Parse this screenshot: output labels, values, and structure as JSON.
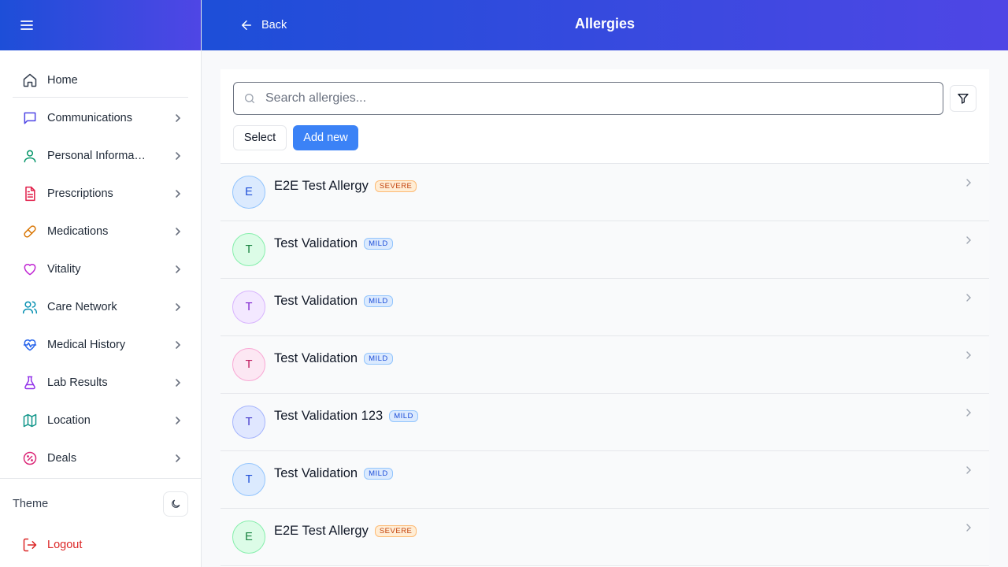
{
  "sidebar": {
    "items": [
      {
        "label": "Home",
        "icon": "home-icon",
        "color": "#374151"
      },
      {
        "label": "Communications",
        "icon": "message-square-icon",
        "color": "#4f46e5"
      },
      {
        "label": "Personal Information",
        "icon": "user-icon",
        "color": "#059669"
      },
      {
        "label": "Prescriptions",
        "icon": "file-text-icon",
        "color": "#e11d48"
      },
      {
        "label": "Medications",
        "icon": "pill-icon",
        "color": "#d97706"
      },
      {
        "label": "Vitality",
        "icon": "heart-icon",
        "color": "#c026d3"
      },
      {
        "label": "Care Network",
        "icon": "users-icon",
        "color": "#0891b2"
      },
      {
        "label": "Medical History",
        "icon": "heart-pulse-icon",
        "color": "#2563eb"
      },
      {
        "label": "Lab Results",
        "icon": "flask-icon",
        "color": "#9333ea"
      },
      {
        "label": "Location",
        "icon": "map-icon",
        "color": "#0d9488"
      },
      {
        "label": "Deals",
        "icon": "badge-percent-icon",
        "color": "#db2777"
      }
    ],
    "theme_label": "Theme",
    "logout_label": "Logout"
  },
  "header": {
    "back_label": "Back",
    "title": "Allergies"
  },
  "toolbar": {
    "search_placeholder": "Search allergies...",
    "select_label": "Select",
    "add_label": "Add new"
  },
  "allergies": [
    {
      "initial": "E",
      "name": "E2E Test Allergy",
      "severity": "SEVERE",
      "avatar_bg": "#dbeafe",
      "avatar_fg": "#1d4ed8",
      "avatar_border": "#93c5fd"
    },
    {
      "initial": "T",
      "name": "Test Validation",
      "severity": "MILD",
      "avatar_bg": "#dcfce7",
      "avatar_fg": "#15803d",
      "avatar_border": "#86efac"
    },
    {
      "initial": "T",
      "name": "Test Validation",
      "severity": "MILD",
      "avatar_bg": "#f3e8ff",
      "avatar_fg": "#7e22ce",
      "avatar_border": "#d8b4fe"
    },
    {
      "initial": "T",
      "name": "Test Validation",
      "severity": "MILD",
      "avatar_bg": "#fce7f3",
      "avatar_fg": "#be185d",
      "avatar_border": "#f9a8d4"
    },
    {
      "initial": "T",
      "name": "Test Validation 123",
      "severity": "MILD",
      "avatar_bg": "#e0e7ff",
      "avatar_fg": "#4338ca",
      "avatar_border": "#a5b4fc"
    },
    {
      "initial": "T",
      "name": "Test Validation",
      "severity": "MILD",
      "avatar_bg": "#dbeafe",
      "avatar_fg": "#1d4ed8",
      "avatar_border": "#93c5fd"
    },
    {
      "initial": "E",
      "name": "E2E Test Allergy",
      "severity": "SEVERE",
      "avatar_bg": "#dcfce7",
      "avatar_fg": "#15803d",
      "avatar_border": "#86efac"
    }
  ]
}
